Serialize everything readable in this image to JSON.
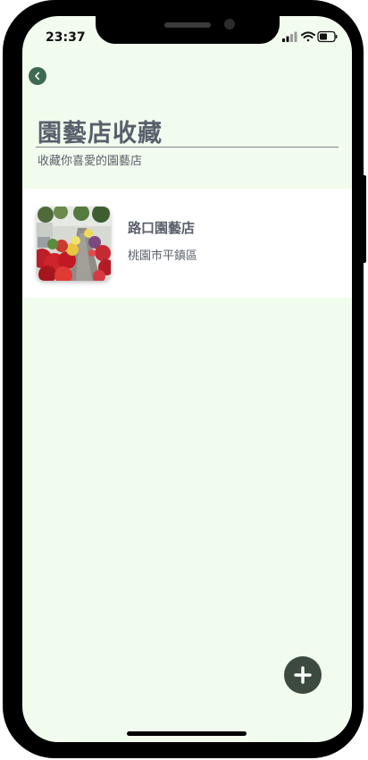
{
  "status_bar": {
    "time": "23:37",
    "signal_icon": "cellular-signal-icon",
    "wifi_icon": "wifi-icon",
    "battery_icon": "battery-icon"
  },
  "header": {
    "back_icon": "chevron-left-icon",
    "title": "園藝店收藏",
    "subtitle": "收藏你喜愛的園藝店"
  },
  "stores": [
    {
      "name": "路口園藝店",
      "location": "桃園市平鎮區",
      "image": "flower-market-photo"
    }
  ],
  "fab": {
    "icon": "plus-icon"
  },
  "colors": {
    "screen_background": "#f2fcee",
    "card_background": "#ffffff",
    "accent_green": "#3f6a52",
    "fab_background": "#3c4a40",
    "text_gray": "#5a606a"
  }
}
